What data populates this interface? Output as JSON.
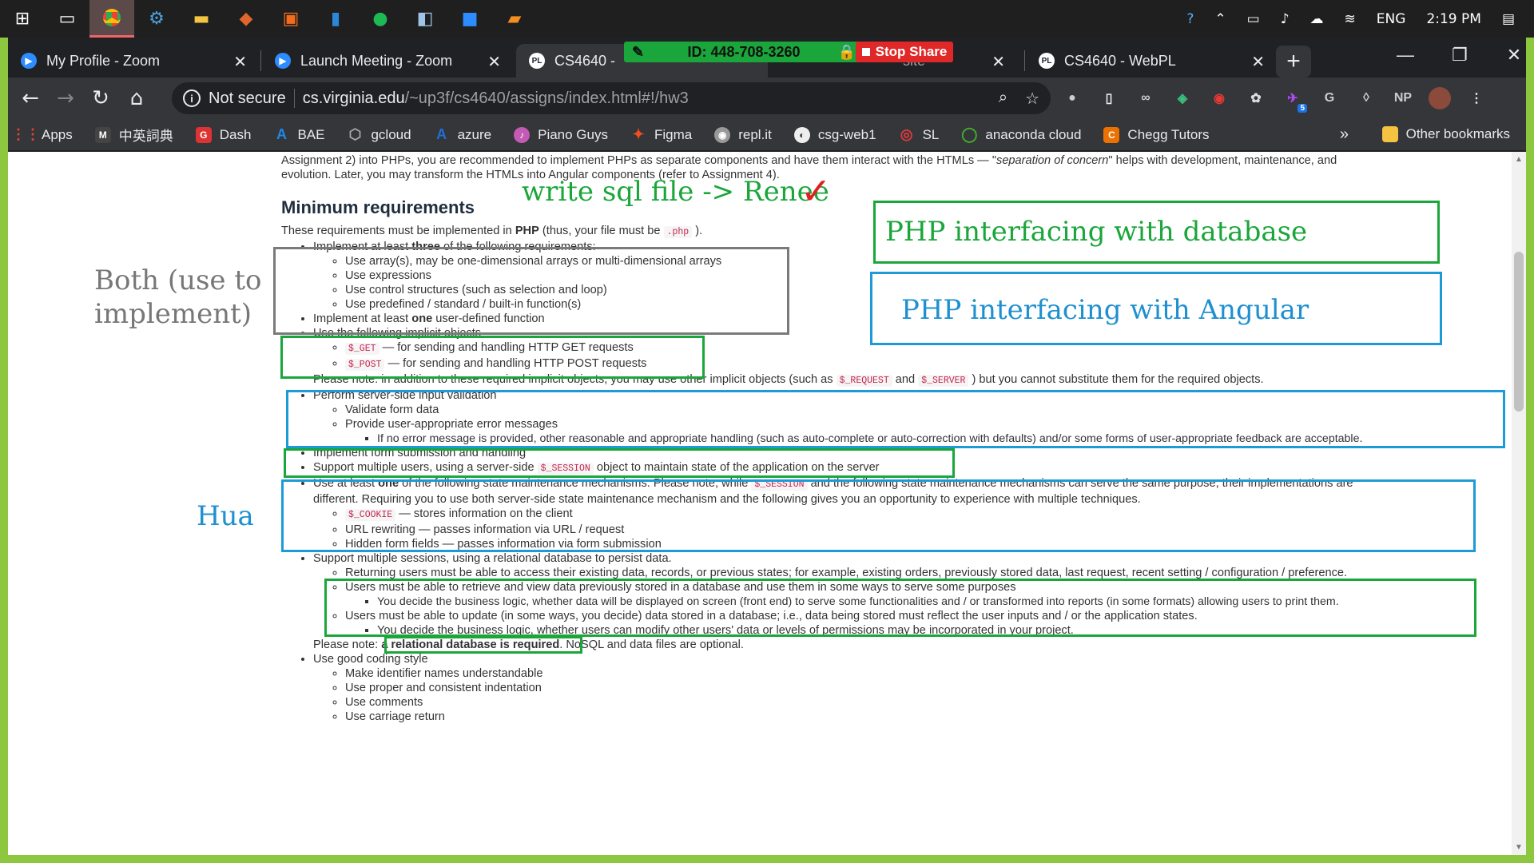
{
  "taskbar": {
    "icons": [
      "windows-start",
      "task-view",
      "chrome",
      "app-3",
      "file-explorer",
      "app-5",
      "app-6",
      "app-7",
      "spotify",
      "app-9",
      "zoom",
      "sublime"
    ],
    "language": "ENG",
    "time": "2:19 PM"
  },
  "tabs": [
    {
      "title": "My Profile - Zoom",
      "icon": "zoom"
    },
    {
      "title": "Launch Meeting - Zoom",
      "icon": "zoom"
    },
    {
      "title": "CS4640 -",
      "icon": "pl"
    },
    {
      "title": "site",
      "icon": ""
    },
    {
      "title": "CS4640 - WebPL",
      "icon": "pl"
    }
  ],
  "zoom_bar": {
    "meeting_id": "ID: 448-708-3260",
    "stop_share": "Stop Share"
  },
  "omnibox": {
    "security_label": "Not secure",
    "url_host": "cs.virginia.edu",
    "url_path": "/~up3f/cs4640/assigns/index.html#!/hw3"
  },
  "extensions": [
    "ext-1",
    "ext-2",
    "ext-3",
    "ext-4",
    "ext-5",
    "ext-6",
    "ext-7",
    "G",
    "ext-9",
    "NP",
    "profile"
  ],
  "extension_badge": "5",
  "bookmarks": [
    {
      "label": "Apps",
      "color": "#ea4335"
    },
    {
      "label": "中英詞典",
      "color": "#444"
    },
    {
      "label": "Dash",
      "color": "#d33"
    },
    {
      "label": "BAE",
      "color": "#1e88e5"
    },
    {
      "label": "gcloud",
      "color": "#888"
    },
    {
      "label": "azure",
      "color": "#1e6fd8"
    },
    {
      "label": "Piano Guys",
      "color": "#c45ab3"
    },
    {
      "label": "Figma",
      "color": "#f24e1e"
    },
    {
      "label": "repl.it",
      "color": "#999"
    },
    {
      "label": "csg-web1",
      "color": "#777"
    },
    {
      "label": "SL",
      "color": "#e4393c"
    },
    {
      "label": "anaconda cloud",
      "color": "#43b02a"
    },
    {
      "label": "Chegg Tutors",
      "color": "#eb7100"
    }
  ],
  "bookmarks_more": "»",
  "bookmarks_other": "Other bookmarks",
  "doc": {
    "intro_line1": "Assignment 2) into PHPs, you are recommended to implement PHPs as separate components and have them interact with the HTMLs — \"",
    "intro_italic": "separation of concern",
    "intro_line1_end": "\" helps with development, maintenance, and",
    "intro_line2": "evolution. Later, you may transform the HTMLs into Angular components (refer to Assignment 4).",
    "heading": "Minimum requirements",
    "req_note_a": "These requirements must be implemented in ",
    "req_note_php": "PHP",
    "req_note_b": " (thus, your file must be ",
    "req_note_code": ".php",
    "req_note_c": " ).",
    "item1_a": "Implement at least ",
    "item1_bold": "three",
    "item1_b": " of the following requirements:",
    "item1_subs": [
      "Use array(s), may be one-dimensional arrays or multi-dimensional arrays",
      "Use expressions",
      "Use control structures (such as selection and loop)",
      "Use predefined / standard / built-in function(s)"
    ],
    "item2_a": "Implement at least ",
    "item2_bold": "one",
    "item2_b": " user-defined function",
    "item3": "Use the following implicit objects",
    "item3_get_code": "$_GET",
    "item3_get_text": " — for sending and handling HTTP GET requests",
    "item3_post_code": "$_POST",
    "item3_post_text": " — for sending and handling HTTP POST requests",
    "item3_note_a": "Please note: in addition to these required implicit objects, you may use other implicit objects (such as ",
    "item3_note_code1": "$_REQUEST",
    "item3_note_b": " and ",
    "item3_note_code2": "$_SERVER",
    "item3_note_c": " ) but you cannot substitute them for the required objects.",
    "item4": "Perform server-side input validation",
    "item4_sub1": "Validate form data",
    "item4_sub2": "Provide user-appropriate error messages",
    "item4_sub2_sub": "If no error message is provided, other reasonable and appropriate handling (such as auto-complete or auto-correction with defaults) and/or some forms of user-appropriate feedback are acceptable.",
    "item5": "Implement form submission and handling",
    "item6_a": "Support multiple users, using a server-side ",
    "item6_code": "$_SESSION",
    "item6_b": " object to maintain state of the application on the server",
    "item7_a": "Use at least ",
    "item7_bold": "one",
    "item7_b": " of the following state maintenance mechanisms. Please note, while ",
    "item7_code": "$_SESSION",
    "item7_c": " and the following state maintenance mechanisms can serve the same purpose, their implementations are",
    "item7_line2": "different. Requiring you to use both server-side state maintenance mechanism and the following gives you an opportunity to experience with multiple techniques.",
    "item7_cookie_code": "$_COOKIE",
    "item7_cookie_text": " — stores information on the client",
    "item7_sub2": "URL rewriting — passes information via URL / request",
    "item7_sub3": "Hidden form fields — passes information via form submission",
    "item8": "Support multiple sessions, using a relational database to persist data.",
    "item8_sub1": "Returning users must be able to access their existing data, records, or previous states; for example, existing orders, previously stored data, last request, recent setting / configuration / preference.",
    "item8_sub2": "Users must be able to retrieve and view data previously stored in a database and use them in some ways to serve some purposes",
    "item8_sub2_sub": "You decide the business logic, whether data will be displayed on screen (front end) to serve some functionalities and / or transformed into reports (in some formats) allowing users to print them.",
    "item8_sub3": "Users must be able to update (in some ways, you decide) data stored in a database; i.e., data being stored must reflect the user inputs and / or the application states.",
    "item8_sub3_sub": "You decide the business logic, whether users can modify other users' data or levels of permissions may be incorporated in your project.",
    "item8_note_a": "Please note: ",
    "item8_note_bold": "a relational database is required",
    "item8_note_b": ". NoSQL and data files are optional.",
    "item9": "Use good coding style",
    "item9_subs": [
      "Make identifier names understandable",
      "Use proper and consistent indentation",
      "Use comments",
      "Use carriage return"
    ]
  },
  "annotations": {
    "sql_note": "write sql file -> Renee",
    "checkmark": "✓",
    "php_db": "PHP interfacing with database",
    "php_angular": "PHP interfacing with Angular",
    "both_line1": "Both (use to",
    "both_line2": "implement)",
    "hua": "Hua",
    "colors": {
      "green": "#1aa63a",
      "blue": "#1e9bd7",
      "gray": "#7a7a7a",
      "check": "#e02020"
    }
  }
}
